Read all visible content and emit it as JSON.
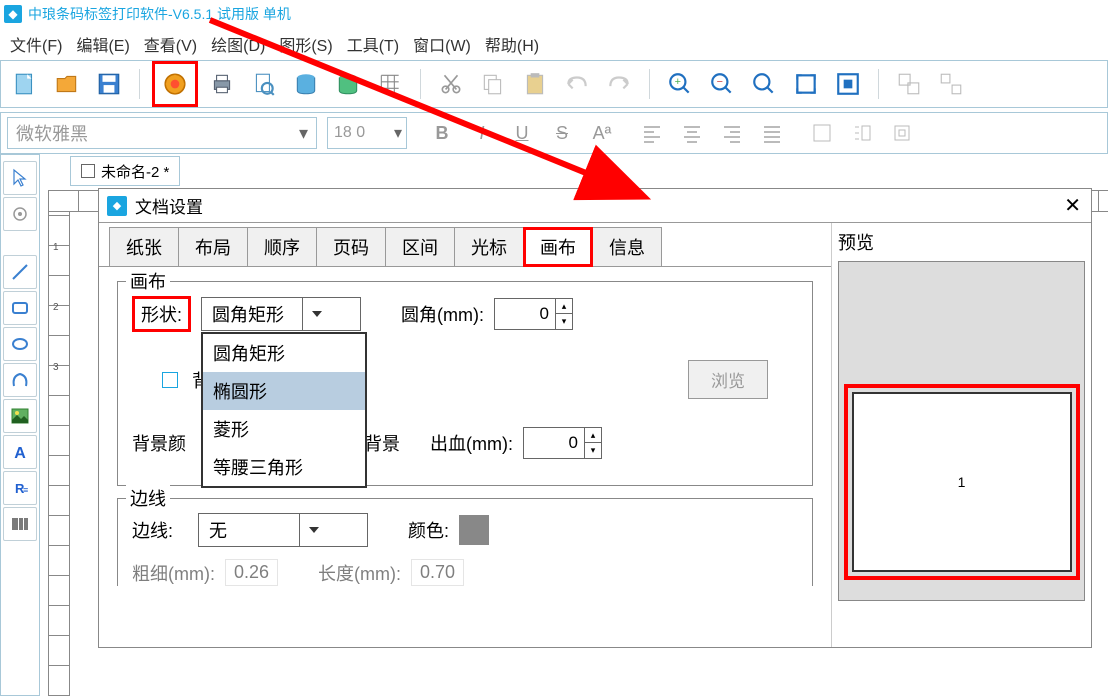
{
  "titlebar": {
    "title": "中琅条码标签打印软件-V6.5.1 试用版 单机"
  },
  "menubar": {
    "items": [
      {
        "label": "文件(F)"
      },
      {
        "label": "编辑(E)"
      },
      {
        "label": "查看(V)"
      },
      {
        "label": "绘图(D)"
      },
      {
        "label": "图形(S)"
      },
      {
        "label": "工具(T)"
      },
      {
        "label": "窗口(W)"
      },
      {
        "label": "帮助(H)"
      }
    ]
  },
  "format": {
    "font_placeholder": "微软雅黑",
    "font_size": "18 0"
  },
  "doc_tab": {
    "label": "未命名-2 *"
  },
  "dialog": {
    "title": "文档设置",
    "tabs": [
      {
        "label": "纸张"
      },
      {
        "label": "布局"
      },
      {
        "label": "顺序"
      },
      {
        "label": "页码"
      },
      {
        "label": "区间"
      },
      {
        "label": "光标"
      },
      {
        "label": "画布"
      },
      {
        "label": "信息"
      }
    ],
    "active_tab": 6,
    "canvas_section": {
      "legend": "画布",
      "shape_label": "形状:",
      "shape_value": "圆角矩形",
      "shape_options": [
        {
          "label": "圆角矩形"
        },
        {
          "label": "椭圆形"
        },
        {
          "label": "菱形"
        },
        {
          "label": "等腰三角形"
        }
      ],
      "corner_label": "圆角(mm):",
      "corner_value": "0",
      "bg_label": "背景",
      "browse_label": "浏览",
      "bgcolor_label": "背景颜",
      "printbg_label": "印背景",
      "bleed_label": "出血(mm):",
      "bleed_value": "0"
    },
    "border_section": {
      "legend": "边线",
      "border_label": "边线:",
      "border_value": "无",
      "color_label": "颜色:",
      "weight_label": "粗细(mm):",
      "weight_value": "0.26",
      "length_label": "长度(mm):",
      "length_value": "0.70"
    },
    "preview": {
      "label": "预览",
      "page_num": "1"
    }
  },
  "ruler_v_labels": [
    "1",
    "2",
    "3"
  ]
}
